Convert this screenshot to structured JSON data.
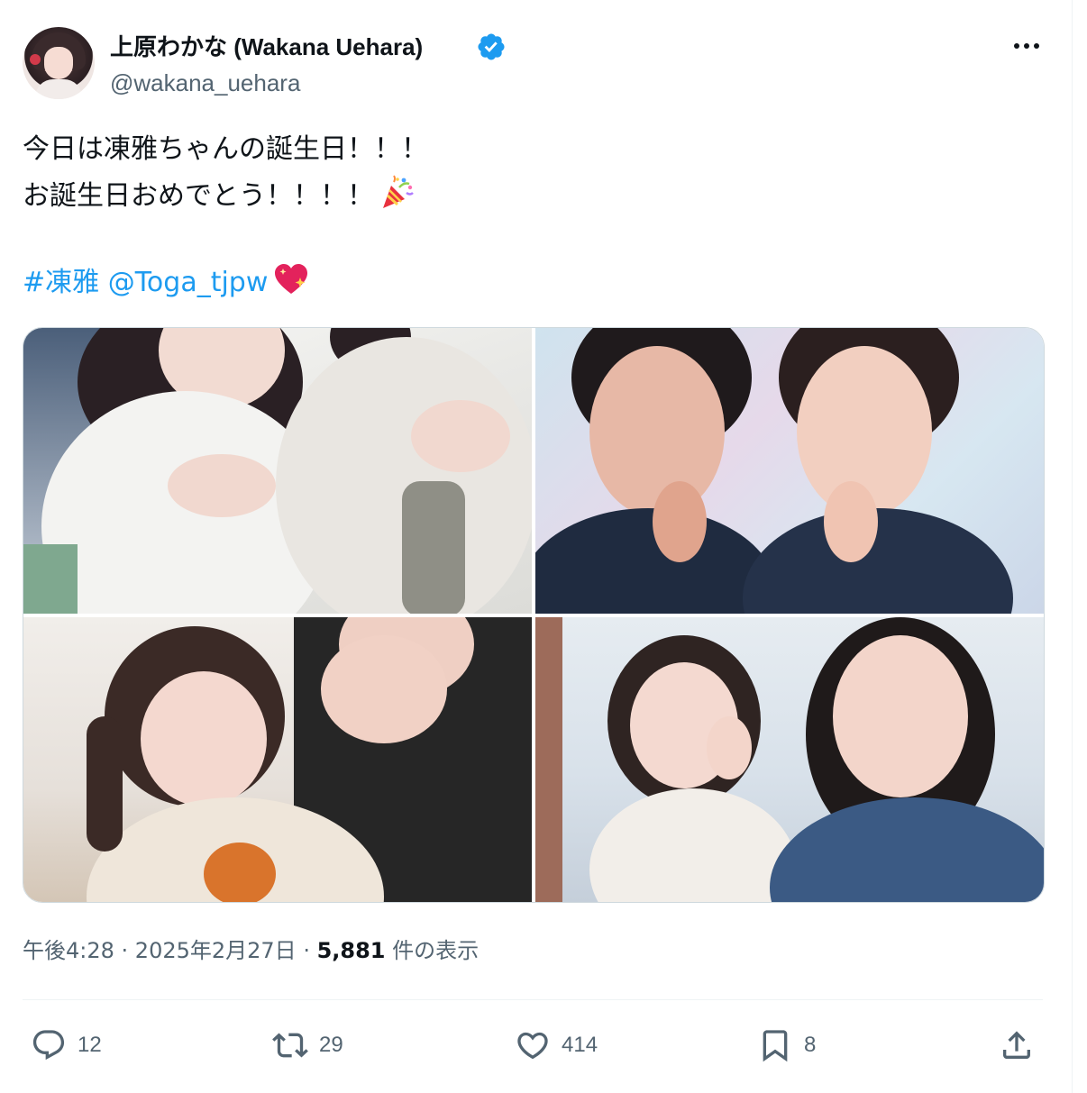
{
  "author": {
    "display_name": "上原わかな (Wakana Uehara)",
    "handle": "@wakana_uehara",
    "verified": true,
    "verified_color": "#1d9bf0"
  },
  "tweet": {
    "line1": "今日は凍雅ちゃんの誕生日！！！",
    "line2": "お誕生日おめでとう！！！！",
    "line2_emoji": "party-popper",
    "hashtag": "#凍雅",
    "mention": "@Toga_tjpw",
    "line4_emoji": "sparkling-heart",
    "link_color": "#1d9bf0"
  },
  "media": {
    "photos": [
      {
        "name": "photo-1",
        "alt": "Two people in white fleece jackets posing with pointing gestures"
      },
      {
        "name": "photo-2",
        "alt": "Two people posing with finger on cheek in front of a TJPW backdrop"
      },
      {
        "name": "photo-3",
        "alt": "Selfie of two people, one with pigtails making a pouting face"
      },
      {
        "name": "photo-4",
        "alt": "Selfie of two people indoors, one wearing a denim jacket"
      }
    ]
  },
  "meta": {
    "time": "午後4:28",
    "sep1": " · ",
    "date": "2025年2月27日",
    "sep2": " · ",
    "views_count": "5,881",
    "views_label": " 件の表示"
  },
  "actions": {
    "replies": "12",
    "reposts": "29",
    "likes": "414",
    "bookmarks": "8"
  }
}
